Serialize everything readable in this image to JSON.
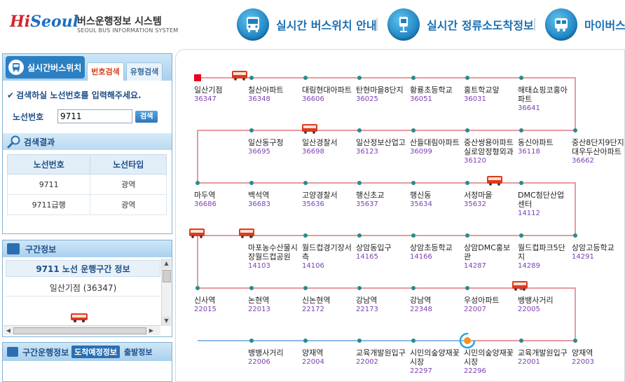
{
  "header": {
    "logo_hi": "Hi",
    "logo_seoul": "Seoul",
    "title": "버스운행정보 시스템",
    "subtitle": "SEOUL BUS INFORMATION SYSTEM",
    "nav": [
      {
        "label": "실시간 버스위치 안내",
        "icon": "bus-front-icon"
      },
      {
        "label": "실시간 정류소도착정보",
        "icon": "bus-stop-icon"
      },
      {
        "label": "마이버스",
        "icon": "my-bus-icon"
      }
    ]
  },
  "left": {
    "tab_main": "실시간버스위치",
    "tab_number": "번호검색",
    "tab_type": "유형검색",
    "instruction": "검색하실 노선번호를 입력해주세요.",
    "route_label": "노선번호",
    "route_value": "9711",
    "search_button": "검색",
    "results_title": "검색결과",
    "results_headers": [
      "노선번호",
      "노선타입"
    ],
    "results": [
      {
        "number": "9711",
        "type": "광역"
      },
      {
        "number": "9711급행",
        "type": "광역"
      }
    ],
    "section_title": "구간정보",
    "section_route_title": "9711 노선 운행구간 정보",
    "section_start": "일산기점 (36347)",
    "segrun_title": "구간운행정보",
    "segrun_tab1": "도착예정정보",
    "segrun_tab2": "출발정보"
  },
  "route": {
    "colors": {
      "line_out": "#e89aa3",
      "line_back": "#8db8e8",
      "stop_dot": "#2a8a8a",
      "start": "#e8001c",
      "id": "#7b3fb3"
    },
    "stops": [
      {
        "name": "일산기점",
        "id": "36347"
      },
      {
        "name": "칠산아파트",
        "id": "36348"
      },
      {
        "name": "대림현대아파트",
        "id": "36606"
      },
      {
        "name": "탄현마을8단지",
        "id": "36025"
      },
      {
        "name": "황룡초등학교",
        "id": "36051"
      },
      {
        "name": "홍트학교앞",
        "id": "36031"
      },
      {
        "name": "해태쇼핑코홍아파트",
        "id": "36641"
      },
      {
        "name": "중산8단지9단지대우두산아파트",
        "id": "36662"
      },
      {
        "name": "동신아파트",
        "id": "36118"
      },
      {
        "name": "중산쌍용아파트실로암정형외과",
        "id": "36120"
      },
      {
        "name": "산들대림아파트",
        "id": "36099"
      },
      {
        "name": "일산정보산업고",
        "id": "36123"
      },
      {
        "name": "일산경찰서",
        "id": "36698"
      },
      {
        "name": "일산동구청",
        "id": "36695"
      },
      {
        "name": "마두역",
        "id": "36686"
      },
      {
        "name": "백석역",
        "id": "36683"
      },
      {
        "name": "고양경찰서",
        "id": "35636"
      },
      {
        "name": "행신초교",
        "id": "35637"
      },
      {
        "name": "행신동",
        "id": "35634"
      },
      {
        "name": "서정마을",
        "id": "35632"
      },
      {
        "name": "DMC첨단산업센터",
        "id": "14112"
      },
      {
        "name": "상암고등학교",
        "id": "14291"
      },
      {
        "name": "월드컵파크5단지",
        "id": "14289"
      },
      {
        "name": "상암DMC홍보관",
        "id": "14287"
      },
      {
        "name": "상암초등학교",
        "id": "14166"
      },
      {
        "name": "상암동입구",
        "id": "14165"
      },
      {
        "name": "월드컵경기장서측",
        "id": "14106"
      },
      {
        "name": "마포농수산물시장월드컵공원",
        "id": "14103"
      },
      {
        "name": "신사역",
        "id": "22015"
      },
      {
        "name": "논현역",
        "id": "22013"
      },
      {
        "name": "신논현역",
        "id": "22172"
      },
      {
        "name": "강남역",
        "id": "22173"
      },
      {
        "name": "강남역",
        "id": "22348"
      },
      {
        "name": "우성아파트",
        "id": "22007"
      },
      {
        "name": "뱅뱅사거리",
        "id": "22005"
      },
      {
        "name": "양재역",
        "id": "22003"
      },
      {
        "name": "교육개발원입구",
        "id": "22001"
      },
      {
        "name": "시민의숲양재꽃시장",
        "id": "22296"
      },
      {
        "name": "시민의숲양재꽃시장",
        "id": "22297"
      },
      {
        "name": "교육개발원입구",
        "id": "22002"
      },
      {
        "name": "양재역",
        "id": "22004"
      },
      {
        "name": "뱅뱅사거리",
        "id": "22006"
      }
    ]
  }
}
